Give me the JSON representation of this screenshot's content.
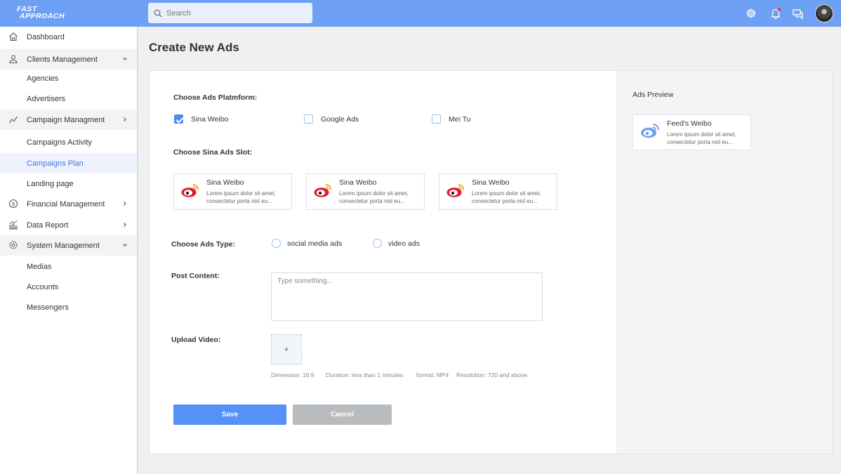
{
  "header": {
    "logo_line1": "FAST",
    "logo_line2": "APPROACH",
    "search_placeholder": "Search"
  },
  "sidebar": {
    "items": [
      {
        "label": "Dashboard",
        "icon": "home-icon"
      },
      {
        "label": "Clients Management",
        "icon": "clients-icon"
      },
      {
        "label": "Agencies"
      },
      {
        "label": "Advertisers"
      },
      {
        "label": "Campaign  Managment",
        "icon": "campaign-icon"
      },
      {
        "label": "Campaigns Activity"
      },
      {
        "label": "Campaigns Plan"
      },
      {
        "label": "Landing page"
      },
      {
        "label": "Financial Management",
        "icon": "financial-icon"
      },
      {
        "label": "Data Report",
        "icon": "data-report-icon"
      },
      {
        "label": "System Management",
        "icon": "system-gear-icon"
      },
      {
        "label": "Medias"
      },
      {
        "label": "Accounts"
      },
      {
        "label": "Messengers"
      }
    ]
  },
  "page": {
    "title": "Create New Ads"
  },
  "form": {
    "platform_label": "Choose Ads Platmform:",
    "platforms": [
      {
        "label": "Sina Weibo",
        "checked": true
      },
      {
        "label": "Google Ads",
        "checked": false
      },
      {
        "label": "Mei Tu",
        "checked": false
      }
    ],
    "slot_label": "Choose Sina Ads Slot:",
    "slots": [
      {
        "title": "Sina Weibo",
        "desc": "Lorem ipsum dolor sit amet, consectetur porta nisl eu..."
      },
      {
        "title": "Sina Weibo",
        "desc": "Lorem ipsum dolor sit amet, consectetur porta nisl eu..."
      },
      {
        "title": "Sina Weibo",
        "desc": "Lorem ipsum dolor sit amet, consectetur porta nisl eu..."
      }
    ],
    "type_label": "Choose Ads Type:",
    "types": [
      "social media ads",
      "video ads"
    ],
    "post_label": "Post Content:",
    "post_placeholder": "Type something...",
    "upload_label": "Upload Video:",
    "upload_plus": "+",
    "hints": [
      "Dimension: 16:9",
      "Duration: less than 1 minutes",
      "format: MP4",
      "Resolution: 720 and above"
    ],
    "save_label": "Save",
    "cancel_label": "Cancel"
  },
  "preview": {
    "label": "Ads Preview",
    "title": "Feed's Weibo",
    "desc": "Lorem ipsum dolor sit amet, consectetur porta nisl eu..."
  },
  "colors": {
    "header": "#6ea0f5",
    "accent": "#4a8af4",
    "weibo_red": "#e6162d",
    "weibo_orange": "#f5a623"
  }
}
